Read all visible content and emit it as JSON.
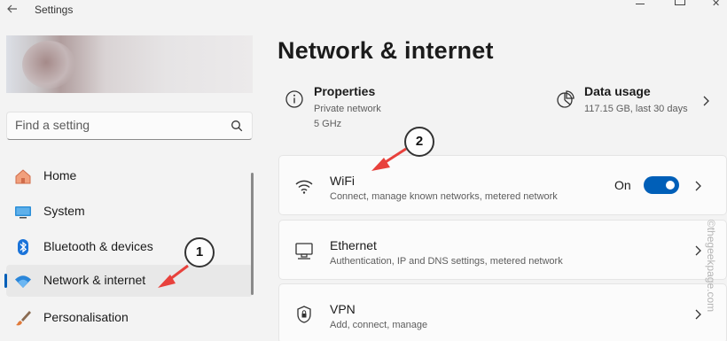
{
  "window": {
    "title": "Settings"
  },
  "search": {
    "placeholder": "Find a setting"
  },
  "nav": [
    {
      "label": "Home",
      "icon": "home-icon"
    },
    {
      "label": "System",
      "icon": "monitor-icon"
    },
    {
      "label": "Bluetooth & devices",
      "icon": "bluetooth-icon"
    },
    {
      "label": "Network & internet",
      "icon": "wifi-icon",
      "active": true
    },
    {
      "label": "Personalisation",
      "icon": "brush-icon"
    }
  ],
  "page": {
    "title": "Network & internet"
  },
  "properties": {
    "title": "Properties",
    "line1": "Private network",
    "line2": "5 GHz"
  },
  "data_usage": {
    "title": "Data usage",
    "line1": "117.15 GB, last 30 days"
  },
  "cards": [
    {
      "title": "WiFi",
      "desc": "Connect, manage known networks, metered network",
      "state": "On",
      "toggle_on": true
    },
    {
      "title": "Ethernet",
      "desc": "Authentication, IP and DNS settings, metered network"
    },
    {
      "title": "VPN",
      "desc": "Add, connect, manage"
    }
  ],
  "annotations": {
    "step1": "1",
    "step2": "2"
  },
  "watermark": "©thegeekpage.com",
  "colors": {
    "accent": "#005fb8",
    "arrow": "#e8413c",
    "background": "#f3f3f3"
  }
}
